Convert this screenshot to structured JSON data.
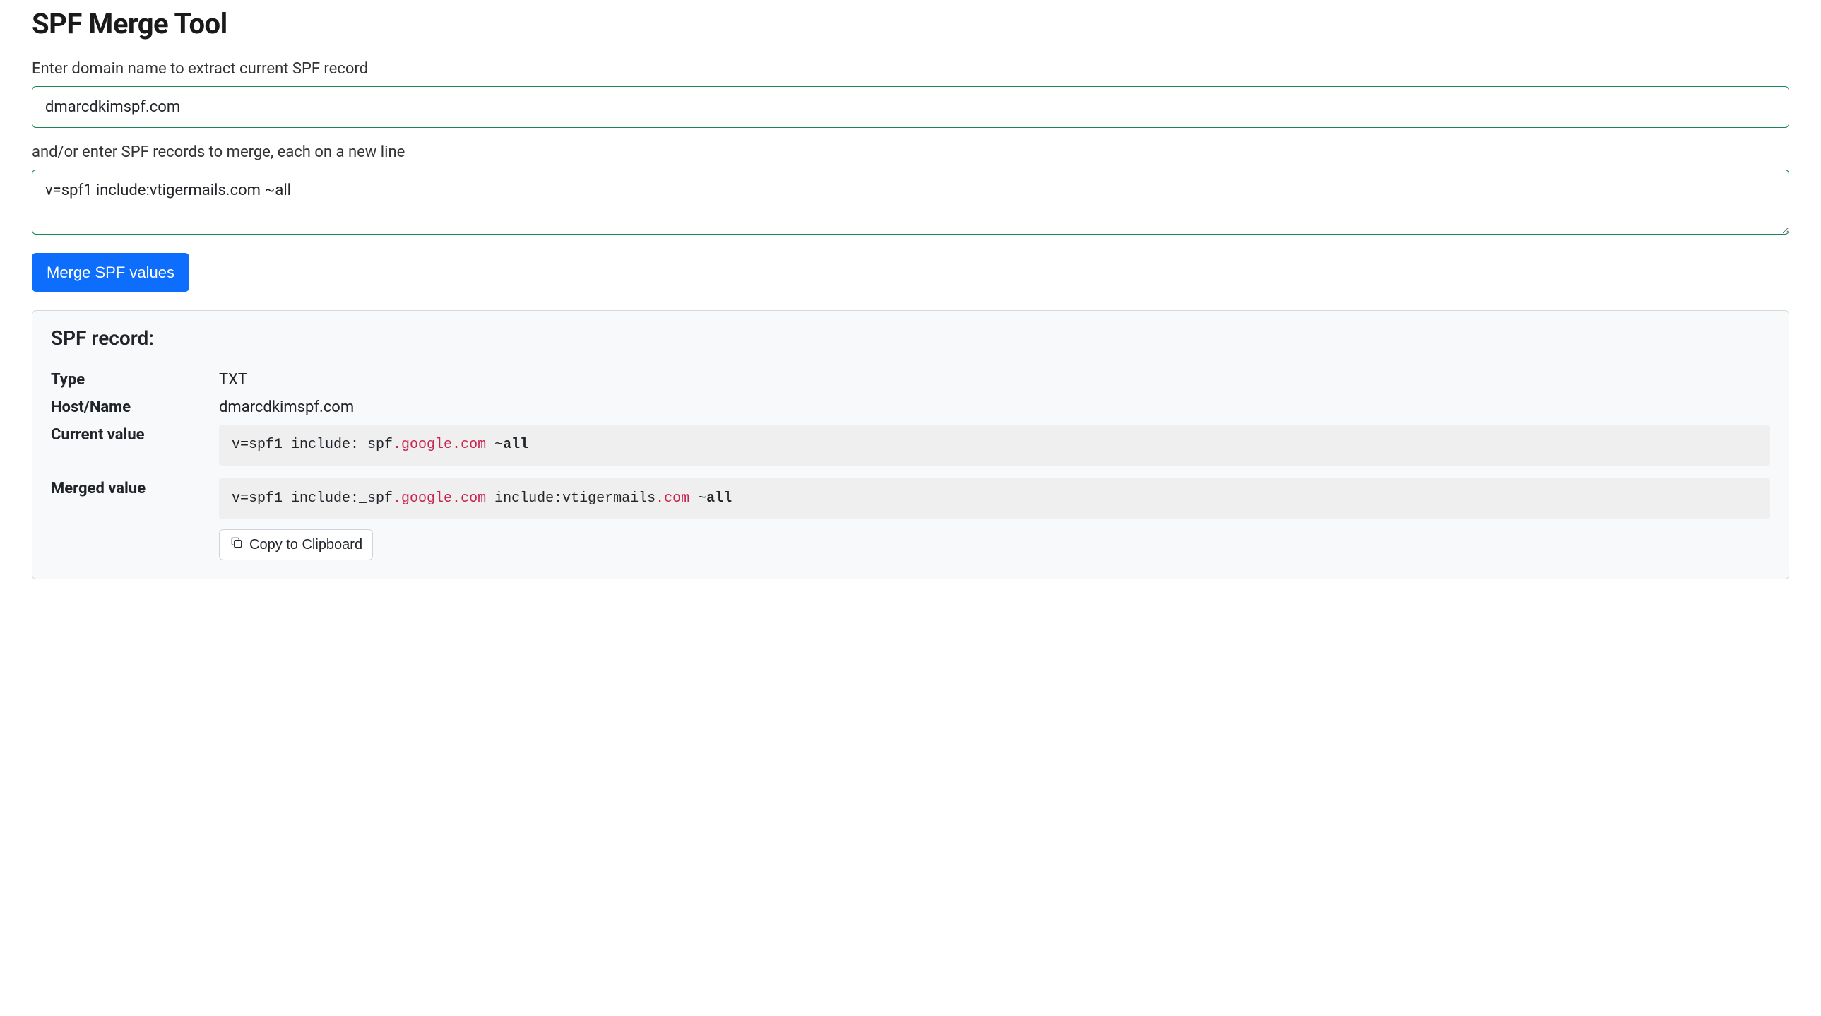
{
  "page": {
    "title": "SPF Merge Tool"
  },
  "form": {
    "domain_label": "Enter domain name to extract current SPF record",
    "domain_value": "dmarcdkimspf.com",
    "spf_label": "and/or enter SPF records to merge, each on a new line",
    "spf_value": "v=spf1 include:vtigermails.com ~all",
    "merge_button": "Merge SPF values"
  },
  "result": {
    "heading": "SPF record:",
    "type_label": "Type",
    "type_value": "TXT",
    "host_label": "Host/Name",
    "host_value": "dmarcdkimspf.com",
    "current_label": "Current value",
    "current_value_tokens": {
      "p1": "v=spf1 include:_spf",
      "p2": ".google.com",
      "p3": " ~",
      "p4": "all"
    },
    "merged_label": "Merged value",
    "merged_value_tokens": {
      "p1": "v=spf1 include:_spf",
      "p2": ".google.com",
      "p3": " include:vtigermails",
      "p4": ".com",
      "p5": " ~",
      "p6": "all"
    },
    "copy_button": "Copy to Clipboard"
  }
}
